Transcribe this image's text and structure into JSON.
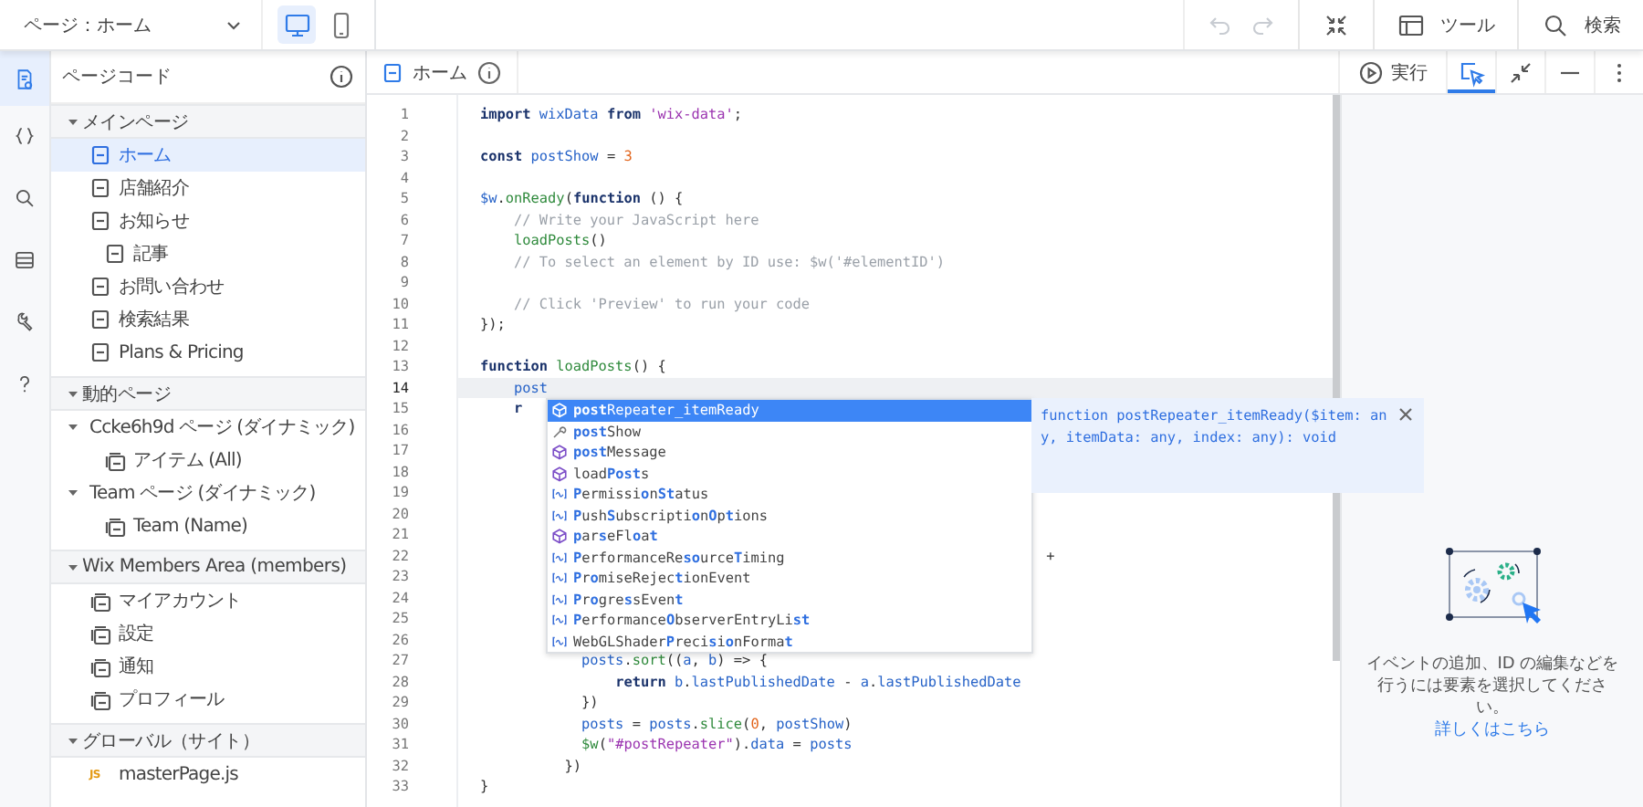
{
  "top_bar": {
    "page_selector": "ページ：ホーム",
    "devices": [
      {
        "kind": "desktop",
        "selected": true
      },
      {
        "kind": "mobile",
        "selected": false
      }
    ],
    "undo": {
      "disabled": true
    },
    "redo": {
      "disabled": true
    },
    "tools_label": "ツール",
    "search_label": "検索"
  },
  "rail": [
    {
      "kind": "page-code",
      "selected": true
    },
    {
      "kind": "braces",
      "selected": false
    },
    {
      "kind": "search",
      "selected": false
    },
    {
      "kind": "database",
      "selected": false
    },
    {
      "kind": "wrench",
      "selected": false
    },
    {
      "kind": "help",
      "selected": false
    }
  ],
  "sidebar": {
    "title": "ページコード",
    "sections": [
      {
        "label": "メインページ",
        "expanded": true,
        "items": [
          {
            "label": "ホーム",
            "kind": "page",
            "selected": true
          },
          {
            "label": "店舗紹介",
            "kind": "page",
            "selected": false
          },
          {
            "label": "お知らせ",
            "kind": "page",
            "selected": false,
            "children": [
              {
                "label": "記事",
                "kind": "page",
                "selected": false
              }
            ]
          },
          {
            "label": "お問い合わせ",
            "kind": "page",
            "selected": false
          },
          {
            "label": "検索結果",
            "kind": "page",
            "selected": false
          },
          {
            "label": "Plans & Pricing",
            "kind": "page",
            "selected": false
          }
        ]
      },
      {
        "label": "動的ページ",
        "expanded": true,
        "items": [
          {
            "label": "Ccke6h9d ページ (ダイナミック)",
            "kind": "group",
            "selected": false,
            "expanded": true,
            "children": [
              {
                "label": "アイテム (All)",
                "kind": "dynamic",
                "selected": false
              }
            ]
          },
          {
            "label": "Team ページ (ダイナミック)",
            "kind": "group",
            "selected": false,
            "expanded": true,
            "children": [
              {
                "label": "Team (Name)",
                "kind": "dynamic",
                "selected": false
              }
            ]
          }
        ]
      },
      {
        "label": "Wix Members Area (members)",
        "expanded": true,
        "items": [
          {
            "label": "マイアカウント",
            "kind": "dynamic",
            "selected": false
          },
          {
            "label": "設定",
            "kind": "dynamic",
            "selected": false
          },
          {
            "label": "通知",
            "kind": "dynamic",
            "selected": false
          },
          {
            "label": "プロフィール",
            "kind": "dynamic",
            "selected": false
          }
        ]
      },
      {
        "label": "グローバル（サイト）",
        "expanded": true,
        "items": [
          {
            "label": "masterPage.js",
            "kind": "script",
            "badge": "JS",
            "selected": false
          }
        ]
      }
    ]
  },
  "editor": {
    "tab": {
      "label": "ホーム"
    },
    "run_label": "実行",
    "tools": [
      {
        "kind": "select-element",
        "selected": true
      },
      {
        "kind": "collapse",
        "selected": false
      },
      {
        "kind": "minimize",
        "selected": false
      },
      {
        "kind": "more",
        "selected": false
      }
    ],
    "lines": [
      {
        "number": "1",
        "current": false,
        "tokens": [
          {
            "kind": "keyword",
            "text": "import "
          },
          {
            "kind": "variable",
            "text": "wixData "
          },
          {
            "kind": "keyword",
            "text": "from "
          },
          {
            "kind": "string",
            "text": "'wix-data'"
          },
          {
            "kind": "plain",
            "text": ";"
          }
        ]
      },
      {
        "number": "2",
        "current": false
      },
      {
        "number": "3",
        "current": false,
        "tokens": [
          {
            "kind": "keyword",
            "text": "const "
          },
          {
            "kind": "variable",
            "text": "postShow"
          },
          {
            "kind": "plain",
            "text": " = "
          },
          {
            "kind": "number",
            "text": "3"
          }
        ]
      },
      {
        "number": "4",
        "current": false
      },
      {
        "number": "5",
        "current": false,
        "tokens": [
          {
            "kind": "variable",
            "text": "$w"
          },
          {
            "kind": "plain",
            "text": "."
          },
          {
            "kind": "function",
            "text": "onReady"
          },
          {
            "kind": "plain",
            "text": "("
          },
          {
            "kind": "keyword",
            "text": "function"
          },
          {
            "kind": "plain",
            "text": " () {"
          }
        ]
      },
      {
        "number": "6",
        "current": false,
        "tokens": [
          {
            "kind": "comment",
            "text": "    // Write your JavaScript here"
          }
        ]
      },
      {
        "number": "7",
        "current": false,
        "tokens": [
          {
            "kind": "function",
            "text": "    loadPosts"
          },
          {
            "kind": "plain",
            "text": "()"
          }
        ]
      },
      {
        "number": "8",
        "current": false,
        "tokens": [
          {
            "kind": "comment",
            "text": "    // To select an element by ID use: $w('#elementID')"
          }
        ]
      },
      {
        "number": "9",
        "current": false
      },
      {
        "number": "10",
        "current": false,
        "tokens": [
          {
            "kind": "comment",
            "text": "    // Click 'Preview' to run your code"
          }
        ]
      },
      {
        "number": "11",
        "current": false,
        "tokens": [
          {
            "kind": "plain",
            "text": "});"
          }
        ]
      },
      {
        "number": "12",
        "current": false
      },
      {
        "number": "13",
        "current": false,
        "tokens": [
          {
            "kind": "keyword",
            "text": "function "
          },
          {
            "kind": "function",
            "text": "loadPosts"
          },
          {
            "kind": "plain",
            "text": "() {"
          }
        ]
      },
      {
        "number": "14",
        "current": true,
        "tokens": [
          {
            "kind": "variable",
            "text": "    post"
          }
        ]
      },
      {
        "number": "15",
        "current": false,
        "tokens": [
          {
            "kind": "keyword",
            "text": "    r"
          }
        ]
      },
      {
        "number": "16",
        "current": false
      },
      {
        "number": "17",
        "current": false
      },
      {
        "number": "18",
        "current": false
      },
      {
        "number": "19",
        "current": false
      },
      {
        "number": "20",
        "current": false
      },
      {
        "number": "21",
        "current": false
      },
      {
        "number": "22",
        "current": false,
        "tokens": [
          {
            "kind": "plain",
            "text": "                                                                   +"
          }
        ]
      },
      {
        "number": "23",
        "current": false
      },
      {
        "number": "24",
        "current": false
      },
      {
        "number": "25",
        "current": false
      },
      {
        "number": "26",
        "current": false
      },
      {
        "number": "27",
        "current": false,
        "tokens": [
          {
            "kind": "variable",
            "text": "            posts"
          },
          {
            "kind": "plain",
            "text": "."
          },
          {
            "kind": "function",
            "text": "sort"
          },
          {
            "kind": "plain",
            "text": "(("
          },
          {
            "kind": "variable",
            "text": "a"
          },
          {
            "kind": "plain",
            "text": ", "
          },
          {
            "kind": "variable",
            "text": "b"
          },
          {
            "kind": "plain",
            "text": ") => {"
          }
        ]
      },
      {
        "number": "28",
        "current": false,
        "tokens": [
          {
            "kind": "keyword",
            "text": "                return "
          },
          {
            "kind": "variable",
            "text": "b"
          },
          {
            "kind": "plain",
            "text": "."
          },
          {
            "kind": "variable",
            "text": "lastPublishedDate"
          },
          {
            "kind": "plain",
            "text": " - "
          },
          {
            "kind": "variable",
            "text": "a"
          },
          {
            "kind": "plain",
            "text": "."
          },
          {
            "kind": "variable",
            "text": "lastPublishedDate"
          }
        ]
      },
      {
        "number": "29",
        "current": false,
        "tokens": [
          {
            "kind": "plain",
            "text": "            })"
          }
        ]
      },
      {
        "number": "30",
        "current": false,
        "tokens": [
          {
            "kind": "variable",
            "text": "            posts"
          },
          {
            "kind": "plain",
            "text": " = "
          },
          {
            "kind": "variable",
            "text": "posts"
          },
          {
            "kind": "plain",
            "text": "."
          },
          {
            "kind": "function",
            "text": "slice"
          },
          {
            "kind": "plain",
            "text": "("
          },
          {
            "kind": "number",
            "text": "0"
          },
          {
            "kind": "plain",
            "text": ", "
          },
          {
            "kind": "variable",
            "text": "postShow"
          },
          {
            "kind": "plain",
            "text": ")"
          }
        ]
      },
      {
        "number": "31",
        "current": false,
        "tokens": [
          {
            "kind": "function",
            "text": "            $w"
          },
          {
            "kind": "plain",
            "text": "("
          },
          {
            "kind": "string",
            "text": "\"#postRepeater\""
          },
          {
            "kind": "plain",
            "text": ")."
          },
          {
            "kind": "variable",
            "text": "data"
          },
          {
            "kind": "plain",
            "text": " = "
          },
          {
            "kind": "variable",
            "text": "posts"
          }
        ]
      },
      {
        "number": "32",
        "current": false,
        "tokens": [
          {
            "kind": "plain",
            "text": "          })"
          }
        ]
      },
      {
        "number": "33",
        "current": false,
        "tokens": [
          {
            "kind": "plain",
            "text": "}"
          }
        ]
      }
    ],
    "suggestions": [
      {
        "label": "**post**Repeater_itemReady",
        "kind": "method",
        "selected": true
      },
      {
        "label": "**post**Show",
        "kind": "property",
        "selected": false
      },
      {
        "label": "**post**Message",
        "kind": "method",
        "selected": false
      },
      {
        "label": "load**Post**s",
        "kind": "method",
        "selected": false
      },
      {
        "label": "**P**ermissi**o**n**St**atus",
        "kind": "class",
        "selected": false
      },
      {
        "label": "**P**ush**S**ubscripti**o**n**O**p**t**ions",
        "kind": "class",
        "selected": false
      },
      {
        "label": "**p**ar**s**eFl**o**a**t**",
        "kind": "method",
        "selected": false
      },
      {
        "label": "**P**erformanceRe**so**urce**T**iming",
        "kind": "class",
        "selected": false
      },
      {
        "label": "**P**r**o**miseRejec**t**ionEvent",
        "kind": "class",
        "selected": false
      },
      {
        "label": "**P**r**o**gre**s**sEven**t**",
        "kind": "class",
        "selected": false
      },
      {
        "label": "**P**erformance**O**bserverEntryLi**st**",
        "kind": "class",
        "selected": false
      },
      {
        "label": "WebGLShader**P**reci**s**i**o**nForma**t**",
        "kind": "class",
        "selected": false
      }
    ],
    "suggestion_detail": "function postRepeater_itemReady($item: any, itemData: any, index: any): void"
  },
  "properties_panel": {
    "message": "イベントの追加、ID の編集などを行うには要素を選択してください。",
    "link": "詳しくはこちら"
  }
}
